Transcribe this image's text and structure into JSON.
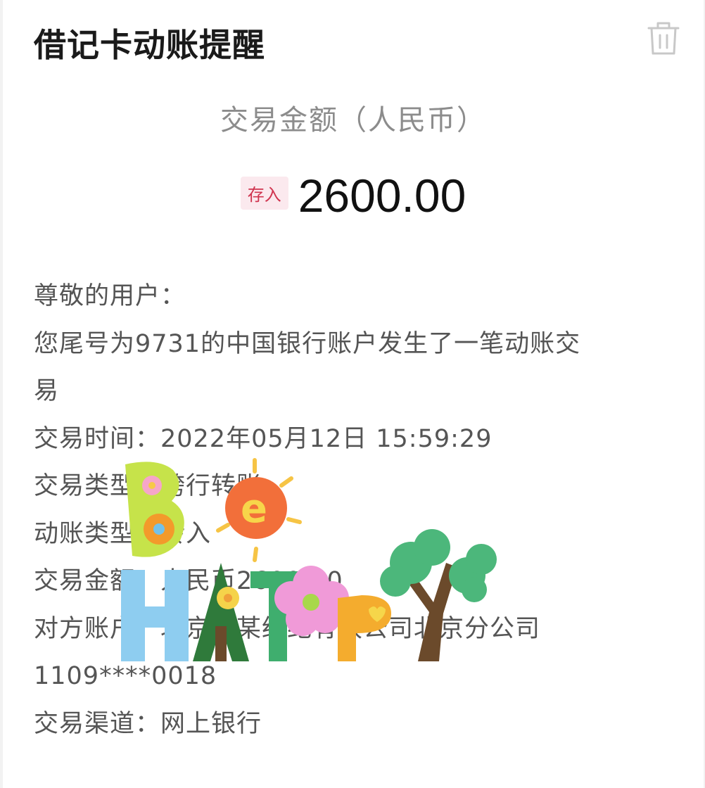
{
  "header": {
    "title": "借记卡动账提醒"
  },
  "amount_section": {
    "label": "交易金额（人民币）",
    "badge": "存入",
    "amount": "2600.00"
  },
  "message": {
    "greeting": "尊敬的用户：",
    "line1": "您尾号为9731的中国银行账户发生了一笔动账交",
    "line2": "易",
    "time": "交易时间：2022年05月12日 15:59:29",
    "type": "交易类型：跨行转账",
    "category": "动账类型：转入",
    "amount": "交易金额：人民币2600.00",
    "counterparty": "对方账户：北京某某经纪有限公司北京分公司",
    "counterparty_account": "1109****0018",
    "channel": "交易渠道：网上银行"
  },
  "sticker": {
    "text": "Be HAPPY"
  },
  "colors": {
    "badge_bg": "#fbe9ee",
    "badge_text": "#d0344f"
  }
}
